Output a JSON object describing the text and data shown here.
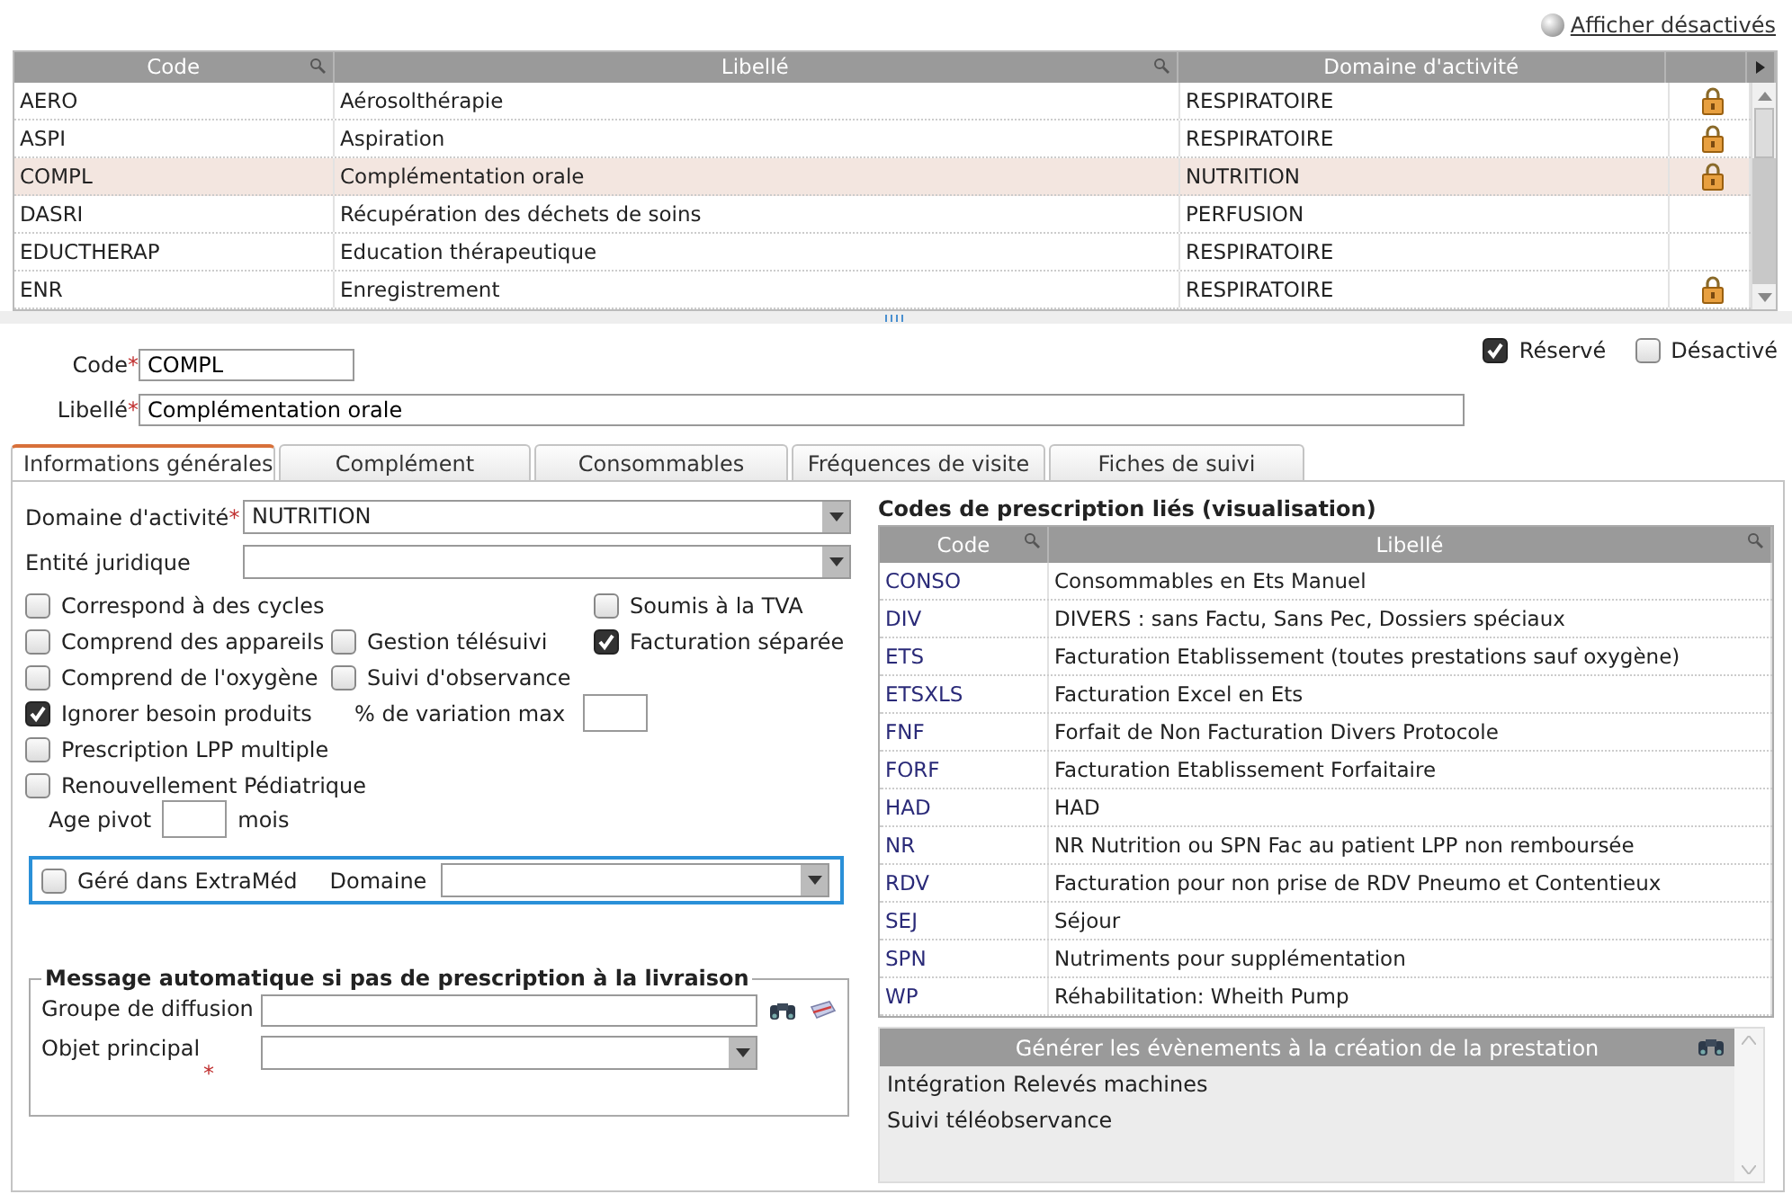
{
  "show_disabled_link": "Afficher désactivés",
  "main_table": {
    "columns": [
      "Code",
      "Libellé",
      "Domaine d'activité"
    ],
    "rows": [
      {
        "code": "AERO",
        "label": "Aérosolthérapie",
        "domain": "RESPIRATOIRE",
        "locked": true,
        "selected": false
      },
      {
        "code": "ASPI",
        "label": "Aspiration",
        "domain": "RESPIRATOIRE",
        "locked": true,
        "selected": false
      },
      {
        "code": "COMPL",
        "label": "Complémentation orale",
        "domain": "NUTRITION",
        "locked": true,
        "selected": true
      },
      {
        "code": "DASRI",
        "label": "Récupération des déchets de soins",
        "domain": "PERFUSION",
        "locked": false,
        "selected": false
      },
      {
        "code": "EDUCTHERAP",
        "label": "Education thérapeutique",
        "domain": "RESPIRATOIRE",
        "locked": false,
        "selected": false
      },
      {
        "code": "ENR",
        "label": "Enregistrement",
        "domain": "RESPIRATOIRE",
        "locked": true,
        "selected": false
      }
    ]
  },
  "header_form": {
    "code": {
      "label": "Code",
      "required_mark": "*",
      "value": "COMPL"
    },
    "label": {
      "label": "Libellé",
      "required_mark": "*",
      "value": "Complémentation orale"
    },
    "flags": [
      {
        "label": "Réservé",
        "checked": true
      },
      {
        "label": "Désactivé",
        "checked": false
      }
    ]
  },
  "tabs": [
    {
      "label": "Informations générales",
      "selected": true
    },
    {
      "label": "Complément",
      "selected": false
    },
    {
      "label": "Consommables",
      "selected": false
    },
    {
      "label": "Fréquences de visite",
      "selected": false
    },
    {
      "label": "Fiches de suivi",
      "selected": false
    }
  ],
  "general": {
    "selects": [
      {
        "label": "Domaine d'activité",
        "required_mark": "*",
        "value": "NUTRITION"
      },
      {
        "label": "Entité juridique"
      }
    ],
    "option_rows": [
      [
        {
          "kind": "checkbox",
          "label": "Correspond à des cycles",
          "checked": false
        },
        {
          "kind": "blank"
        },
        {
          "kind": "checkbox",
          "label": "Soumis à la TVA",
          "checked": false
        }
      ],
      [
        {
          "kind": "checkbox",
          "label": "Comprend des appareils",
          "checked": false
        },
        {
          "kind": "checkbox",
          "label": "Gestion télésuivi",
          "checked": false
        },
        {
          "kind": "checkbox",
          "label": "Facturation séparée",
          "checked": true
        }
      ],
      [
        {
          "kind": "checkbox",
          "label": "Comprend de l'oxygène",
          "checked": false
        },
        {
          "kind": "checkbox",
          "label": "Suivi d'observance",
          "checked": false
        },
        {
          "kind": "blank"
        }
      ],
      [
        {
          "kind": "checkbox",
          "label": "Ignorer besoin produits",
          "checked": true
        },
        {
          "kind": "number_field",
          "label": "% de variation max"
        },
        {
          "kind": "blank"
        }
      ],
      [
        {
          "kind": "checkbox",
          "label": "Prescription LPP multiple",
          "checked": false
        },
        {
          "kind": "blank"
        },
        {
          "kind": "blank"
        }
      ],
      [
        {
          "kind": "checkbox",
          "label": "Renouvellement Pédiatrique",
          "checked": false
        },
        {
          "kind": "blank"
        },
        {
          "kind": "blank"
        }
      ]
    ],
    "age_pivot": {
      "label": "Age pivot",
      "unit": "mois"
    },
    "extramed": {
      "label": "Géré dans ExtraMéd",
      "checked": false,
      "domain_label": "Domaine"
    },
    "auto_message": {
      "title": "Message automatique si pas de prescription à la livraison",
      "group_label": "Groupe de diffusion",
      "object_label": "Objet principal",
      "object_required_mark": "*"
    }
  },
  "linked_codes": {
    "title": "Codes de prescription liés (visualisation)",
    "columns": [
      "Code",
      "Libellé"
    ],
    "rows": [
      {
        "code": "CONSO",
        "label": "Consommables en Ets Manuel"
      },
      {
        "code": "DIV",
        "label": "DIVERS : sans Factu, Sans Pec, Dossiers spéciaux"
      },
      {
        "code": "ETS",
        "label": "Facturation Etablissement (toutes prestations sauf oxygène)"
      },
      {
        "code": "ETSXLS",
        "label": "Facturation Excel en Ets"
      },
      {
        "code": "FNF",
        "label": "Forfait de Non Facturation Divers Protocole"
      },
      {
        "code": "FORF",
        "label": "Facturation Etablissement Forfaitaire"
      },
      {
        "code": "HAD",
        "label": "HAD"
      },
      {
        "code": "NR",
        "label": "NR Nutrition ou SPN Fac au patient LPP non remboursée"
      },
      {
        "code": "RDV",
        "label": "Facturation pour non prise de RDV Pneumo et Contentieux"
      },
      {
        "code": "SEJ",
        "label": "Séjour"
      },
      {
        "code": "SPN",
        "label": "Nutriments pour supplémentation"
      },
      {
        "code": "WP",
        "label": "Réhabilitation: Wheith Pump"
      }
    ]
  },
  "events": {
    "title": "Générer les évènements à la création de la prestation",
    "items": [
      "Intégration Relevés machines",
      "Suivi téléobservance"
    ]
  }
}
